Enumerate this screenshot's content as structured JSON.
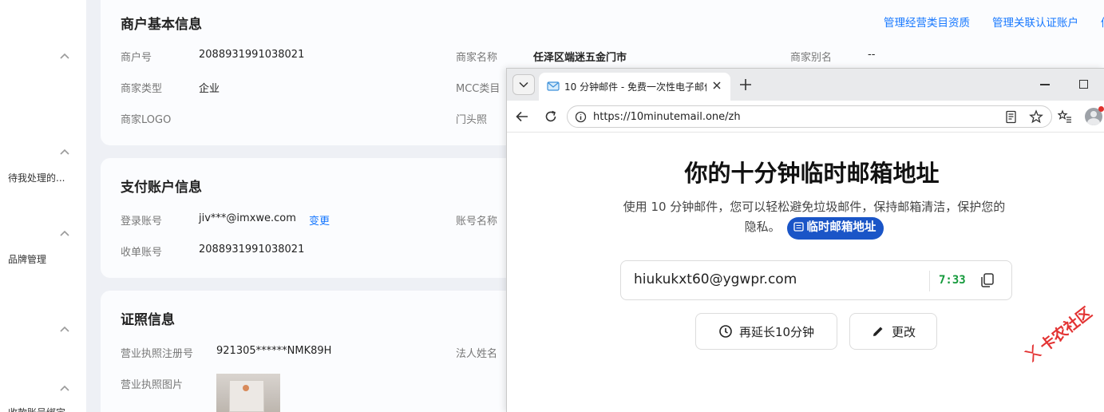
{
  "sidebar": {
    "items": [
      {
        "label": ""
      },
      {
        "label": "待我处理的..."
      },
      {
        "label": "品牌管理"
      },
      {
        "label": ""
      },
      {
        "label": "收款账号绑定"
      }
    ]
  },
  "merchant_info": {
    "title": "商户基本信息",
    "links": [
      "管理经营类目资质",
      "管理关联认证账户",
      "修"
    ],
    "fields": {
      "merchant_id_label": "商户号",
      "merchant_id": "2088931991038021",
      "merchant_name_label": "商家名称",
      "merchant_name": "任泽区端迷五金门市",
      "merchant_alias_label": "商家别名",
      "merchant_alias": "--",
      "merchant_type_label": "商家类型",
      "merchant_type": "企业",
      "mcc_label": "MCC类目",
      "logo_label": "商家LOGO",
      "storefront_label": "门头照"
    }
  },
  "payment_account": {
    "title": "支付账户信息",
    "login_label": "登录账号",
    "login_value": "jiv***@imxwe.com",
    "change_link": "变更",
    "account_name_label": "账号名称",
    "collect_label": "收单账号",
    "collect_value": "2088931991038021"
  },
  "license_info": {
    "title": "证照信息",
    "reg_no_label": "营业执照注册号",
    "reg_no": "921305******NMK89H",
    "legal_label": "法人姓名",
    "image_label": "营业执照图片"
  },
  "browser": {
    "tab_title": "10 分钟邮件 - 免费一次性电子邮件",
    "url": "https://10minutemail.one/zh",
    "page": {
      "heading": "你的十分钟临时邮箱地址",
      "description": "使用 10 分钟邮件，您可以轻松避免垃圾邮件，保持邮箱清洁，保护您的隐私。",
      "badge": "临时邮箱地址",
      "email": "hiukukxt60@ygwpr.com",
      "timer": "7:33",
      "extend_button": "再延长10分钟",
      "change_button": "更改"
    }
  },
  "watermark": "卡农社区",
  "colors": {
    "link": "#1677ff",
    "badge": "#1a55c7",
    "timer": "#159a3c",
    "watermark": "#e33333"
  }
}
